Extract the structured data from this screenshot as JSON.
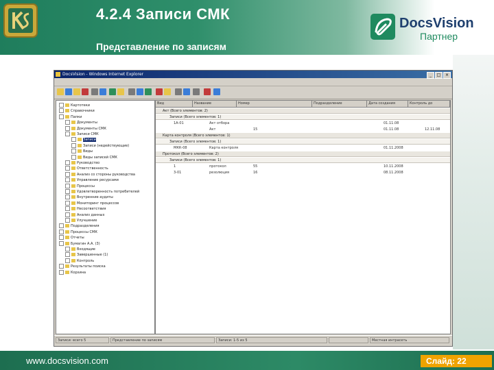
{
  "slide": {
    "title": "4.2.4 Записи СМК",
    "subtitle": "Представление по записям",
    "brand": {
      "name": "DocsVision",
      "tagline": "Партнер"
    },
    "footer_url": "www.docsvision.com",
    "slide_number": "Слайд: 22",
    "colors": {
      "header_green": "#1f7d5c",
      "footer_orange": "#f0a300",
      "brand_green": "#1f8a5f"
    }
  },
  "window": {
    "title": "DocsVision - Windows Internet Explorer",
    "tree": [
      {
        "label": "Картотеки",
        "level": 0,
        "sel": false
      },
      {
        "label": "Справочники",
        "level": 0,
        "sel": false
      },
      {
        "label": "Папки",
        "level": 0,
        "sel": false
      },
      {
        "label": "Документы",
        "level": 1,
        "sel": false
      },
      {
        "label": "Документы СМК",
        "level": 1,
        "sel": false
      },
      {
        "label": "Записи СМК",
        "level": 1,
        "sel": false
      },
      {
        "label": "Записи",
        "level": 2,
        "sel": true
      },
      {
        "label": "Записи (недействующие)",
        "level": 2,
        "sel": false
      },
      {
        "label": "Виды",
        "level": 2,
        "sel": false
      },
      {
        "label": "Виды записей СМК",
        "level": 2,
        "sel": false
      },
      {
        "label": "Руководство",
        "level": 1,
        "sel": false
      },
      {
        "label": "Ответственность",
        "level": 1,
        "sel": false
      },
      {
        "label": "Анализ со стороны руководства",
        "level": 1,
        "sel": false
      },
      {
        "label": "Управление ресурсами",
        "level": 1,
        "sel": false
      },
      {
        "label": "Процессы",
        "level": 1,
        "sel": false
      },
      {
        "label": "Удовлетворенность потребителей",
        "level": 1,
        "sel": false
      },
      {
        "label": "Внутренние аудиты",
        "level": 1,
        "sel": false
      },
      {
        "label": "Мониторинг процессов",
        "level": 1,
        "sel": false
      },
      {
        "label": "Несоответствия",
        "level": 1,
        "sel": false
      },
      {
        "label": "Анализ данных",
        "level": 1,
        "sel": false
      },
      {
        "label": "Улучшение",
        "level": 1,
        "sel": false
      },
      {
        "label": "Подразделения",
        "level": 0,
        "sel": false
      },
      {
        "label": "Процессы СМК",
        "level": 0,
        "sel": false
      },
      {
        "label": "Отчеты",
        "level": 0,
        "sel": false
      },
      {
        "label": "Бумагин А.А. (3)",
        "level": 0,
        "sel": false
      },
      {
        "label": "Входящие",
        "level": 1,
        "sel": false
      },
      {
        "label": "Завершенные (1)",
        "level": 1,
        "sel": false
      },
      {
        "label": "Контроль",
        "level": 1,
        "sel": false
      },
      {
        "label": "Результаты поиска",
        "level": 0,
        "sel": false
      },
      {
        "label": "Корзина",
        "level": 0,
        "sel": false
      }
    ],
    "grid_headers": [
      "Вид",
      "Название",
      "Номер",
      "Подразделение",
      "Дата создания",
      "Контроль до"
    ],
    "groups": [
      {
        "title": "Акт (Всего элементов: 2)",
        "subgroup": "Записи (Всего элементов: 1)",
        "rows": [
          [
            "1А-01",
            "Акт отбора",
            "",
            "",
            "01.11.08",
            ""
          ],
          [
            "",
            "Акт",
            "15",
            "",
            "01.11.08",
            "12.11.08"
          ]
        ]
      },
      {
        "title": "Карта контроля (Всего элементов: 1)",
        "subgroup": "Записи (Всего элементов: 1)",
        "rows": [
          [
            "МКК-08",
            "Карта контроля",
            "",
            "",
            "01.11.2008",
            ""
          ]
        ]
      },
      {
        "title": "Протокол (Всего элементов: 2)",
        "subgroup": "Записи (Всего элементов: 1)",
        "rows": [
          [
            "1",
            "протокол",
            "55",
            "",
            "10.11.2008",
            ""
          ],
          [
            "3-01",
            "резолюция",
            "16",
            "",
            "08.11.2008",
            ""
          ]
        ]
      }
    ],
    "status": [
      "Записи: всего 5",
      "Представление по записям",
      "Записи: 1-5 из 5",
      "",
      "Местная интрасеть"
    ]
  }
}
